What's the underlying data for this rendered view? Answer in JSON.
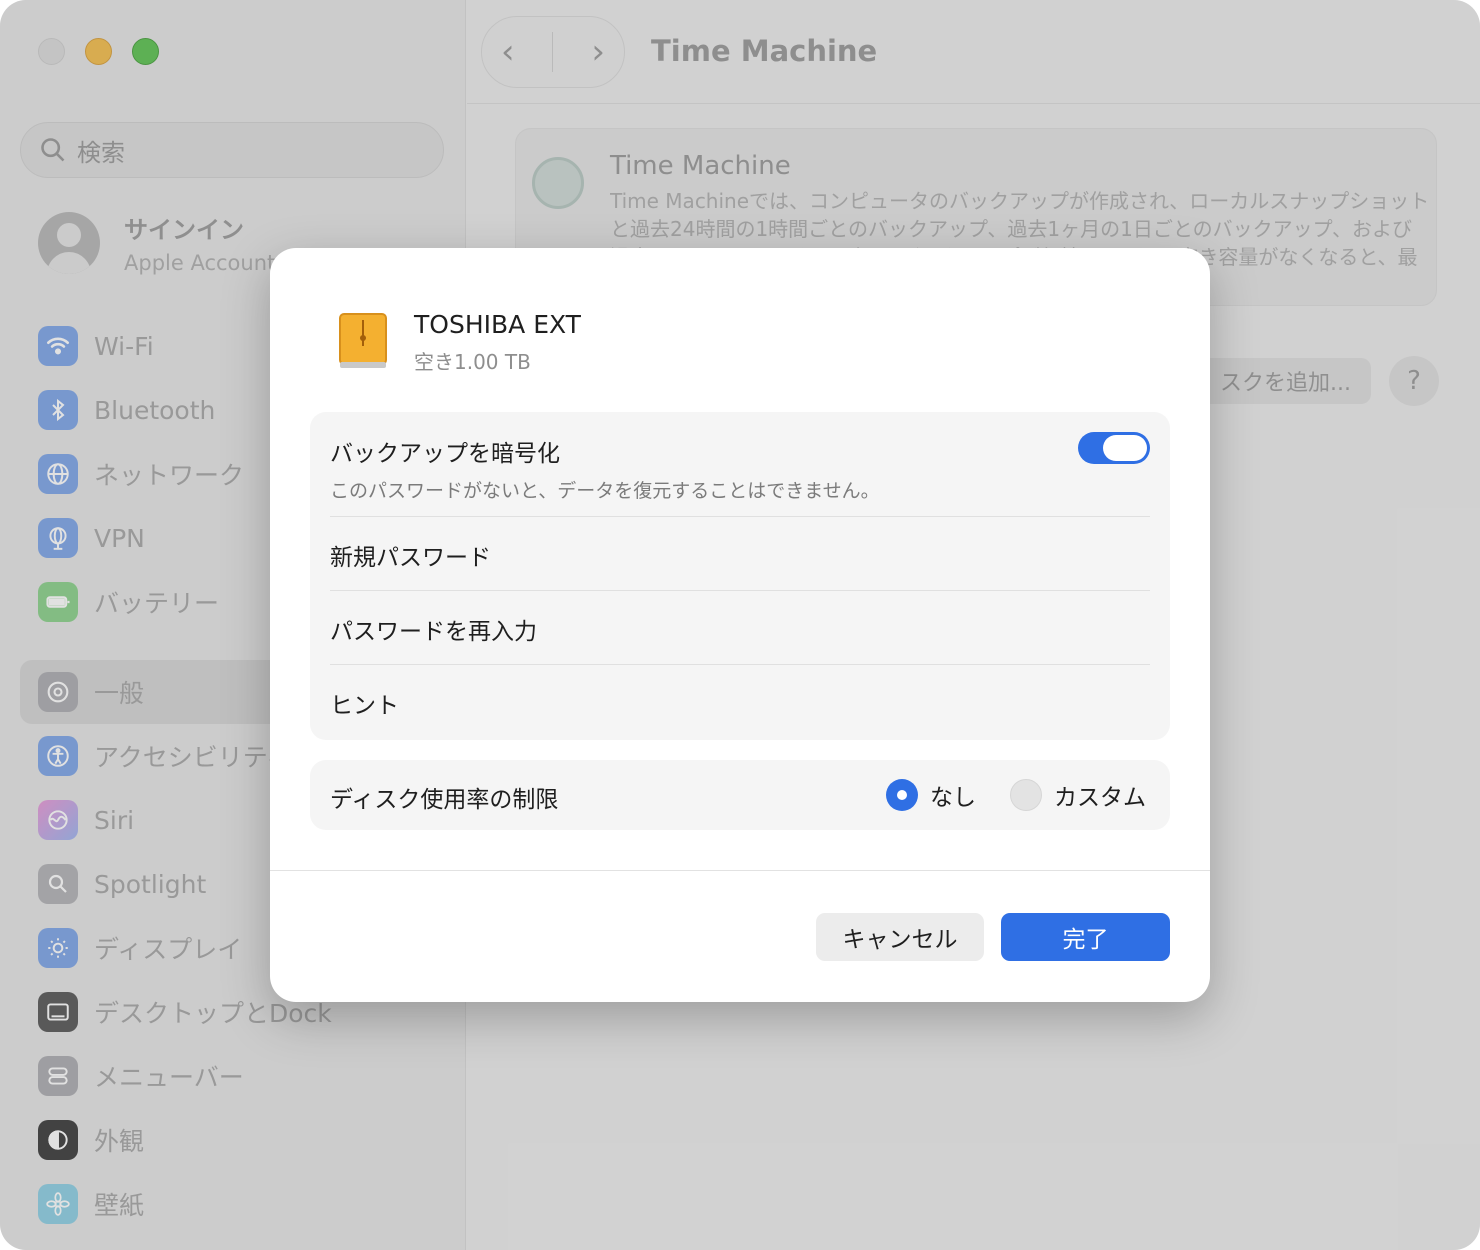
{
  "sidebar": {
    "search_placeholder": "検索",
    "account": {
      "name": "サインイン",
      "subtitle": "Apple Account"
    },
    "items": [
      {
        "label": "Wi-Fi",
        "icon": "wifi-icon",
        "color": "#3b82f6"
      },
      {
        "label": "Bluetooth",
        "icon": "bluetooth-icon",
        "color": "#3b82f6"
      },
      {
        "label": "ネットワーク",
        "icon": "globe-icon",
        "color": "#3b82f6"
      },
      {
        "label": "VPN",
        "icon": "vpn-globe-icon",
        "color": "#3b82f6"
      },
      {
        "label": "バッテリー",
        "icon": "battery-icon",
        "color": "#4cbb4c"
      },
      {
        "label": "一般",
        "icon": "gear-icon",
        "color": "#8e8e93"
      },
      {
        "label": "アクセシビリティ",
        "icon": "accessibility-icon",
        "color": "#3b82f6"
      },
      {
        "label": "Siri",
        "icon": "siri-icon",
        "color": "#d05fd0"
      },
      {
        "label": "Spotlight",
        "icon": "magnifier-icon",
        "color": "#8e8e93"
      },
      {
        "label": "ディスプレイ",
        "icon": "sun-icon",
        "color": "#3b82f6"
      },
      {
        "label": "デスクトップとDock",
        "icon": "dock-icon",
        "color": "#1f1f1f"
      },
      {
        "label": "メニューバー",
        "icon": "menubar-icon",
        "color": "#8e8e93"
      },
      {
        "label": "外観",
        "icon": "appearance-icon",
        "color": "#1f1f1f"
      },
      {
        "label": "壁紙",
        "icon": "flower-icon",
        "color": "#3fb6d6"
      }
    ]
  },
  "main": {
    "title": "Time Machine",
    "card": {
      "title": "Time Machine",
      "description": "Time Machineでは、コンピュータのバックアップが作成され、ローカルスナップショットと過去24時間の1時間ごとのバックアップ、過去1ヶ月の1日ごとのバックアップ、および過去のすべての月の1週間ごとのバックアップが保持されます。空き容量がなくなると、最も古いバックアップが削除されます。"
    },
    "add_disk_label": "スクを追加...",
    "help_label": "?"
  },
  "dialog": {
    "drive_name": "TOSHIBA EXT",
    "drive_free": "空き1.00 TB",
    "encrypt": {
      "title": "バックアップを暗号化",
      "subtitle": "このパスワードがないと、データを復元することはできません。",
      "enabled": true
    },
    "fields": {
      "new_password": "新規パスワード",
      "reenter_password": "パスワードを再入力",
      "hint": "ヒント"
    },
    "disk_limit": {
      "label": "ディスク使用率の制限",
      "option_none": "なし",
      "option_custom": "カスタム",
      "selected": "なし"
    },
    "cancel_label": "キャンセル",
    "done_label": "完了",
    "accent_color": "#2f6fe4"
  }
}
